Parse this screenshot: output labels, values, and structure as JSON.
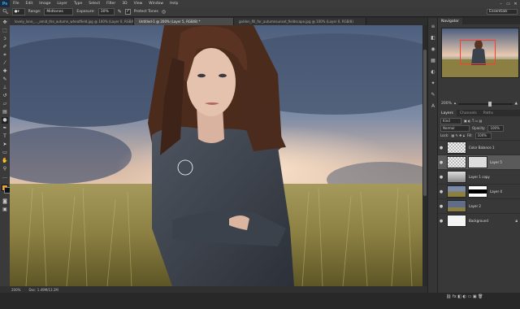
{
  "app": {
    "logo": "Ps"
  },
  "menu": [
    "File",
    "Edit",
    "Image",
    "Layer",
    "Type",
    "Select",
    "Filter",
    "3D",
    "View",
    "Window",
    "Help"
  ],
  "window_controls": [
    "–",
    "▭",
    "✕"
  ],
  "options_bar": {
    "range_label": "Range:",
    "range_value": "Midtones",
    "exposure_label": "Exposure:",
    "exposure_value": "30%",
    "protect_tones_label": "Protect Tones",
    "protect_tones_checked": "✓"
  },
  "workspace": "Essentials",
  "tabs": [
    {
      "label": "lovely_lone_..._amid_the_autumn_wheatfield.jpg @ 100% (Layer 0, RGB/8)"
    },
    {
      "label": "Untitled-1 @ 200% (Layer 5, RGB/8) *"
    },
    {
      "label": "golden_fill_for_autumnsunset_fieldscape.jpg @ 100% (Layer 0, RGB/8)"
    }
  ],
  "status": {
    "zoom": "200%",
    "doc": "Doc: 1.49M/13.2M"
  },
  "navigator": {
    "tabs": [
      "Navigator"
    ],
    "zoom": "200%"
  },
  "adjust_tabs": [
    "Layers",
    "Channels",
    "Paths"
  ],
  "layers_controls": {
    "kind": "Kind",
    "blend": "Normal",
    "opacity_label": "Opacity:",
    "opacity": "100%",
    "lock_label": "Lock:",
    "fill_label": "Fill:",
    "fill": "100%"
  },
  "layers": [
    {
      "name": "Color Balance 1",
      "visible": "●"
    },
    {
      "name": "Layer 5",
      "visible": "●"
    },
    {
      "name": "Layer 1 copy",
      "visible": "●"
    },
    {
      "name": "Layer 4",
      "visible": "●"
    },
    {
      "name": "Layer 2",
      "visible": "●"
    },
    {
      "name": "Background",
      "visible": "●"
    }
  ]
}
